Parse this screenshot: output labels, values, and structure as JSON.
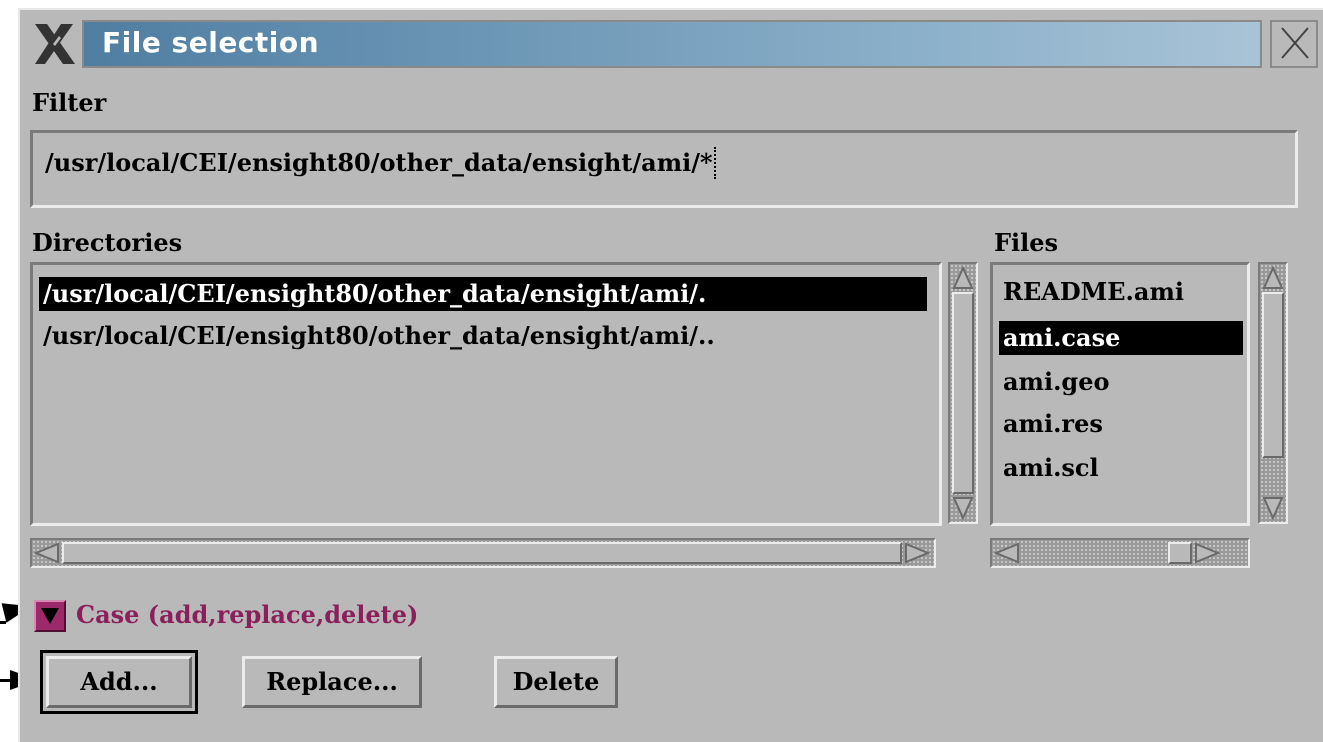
{
  "window": {
    "title": "File selection"
  },
  "filter": {
    "label": "Filter",
    "value": "/usr/local/CEI/ensight80/other_data/ensight/ami/*"
  },
  "directories": {
    "label": "Directories",
    "items": [
      {
        "text": "/usr/local/CEI/ensight80/other_data/ensight/ami/.",
        "selected": true
      },
      {
        "text": "/usr/local/CEI/ensight80/other_data/ensight/ami/..",
        "selected": false
      }
    ]
  },
  "files": {
    "label": "Files",
    "items": [
      {
        "text": "README.ami",
        "selected": false
      },
      {
        "text": "ami.case",
        "selected": true
      },
      {
        "text": "ami.geo",
        "selected": false
      },
      {
        "text": "ami.res",
        "selected": false
      },
      {
        "text": "ami.scl",
        "selected": false
      }
    ]
  },
  "case_section": {
    "label": "Case (add,replace,delete)",
    "expanded": true
  },
  "buttons": {
    "add": "Add...",
    "replace": "Replace...",
    "delete": "Delete"
  },
  "colors": {
    "window_bg": "#b9b9b9",
    "title_gradient_start": "#4f7ea2",
    "selection_bg": "#000000",
    "case_accent": "#8a1f5c"
  },
  "icons": {
    "window_logo": "x-logo-icon",
    "close": "close-icon",
    "toggle": "triangle-down-icon",
    "pointer": "arrow-pointer-icon"
  }
}
